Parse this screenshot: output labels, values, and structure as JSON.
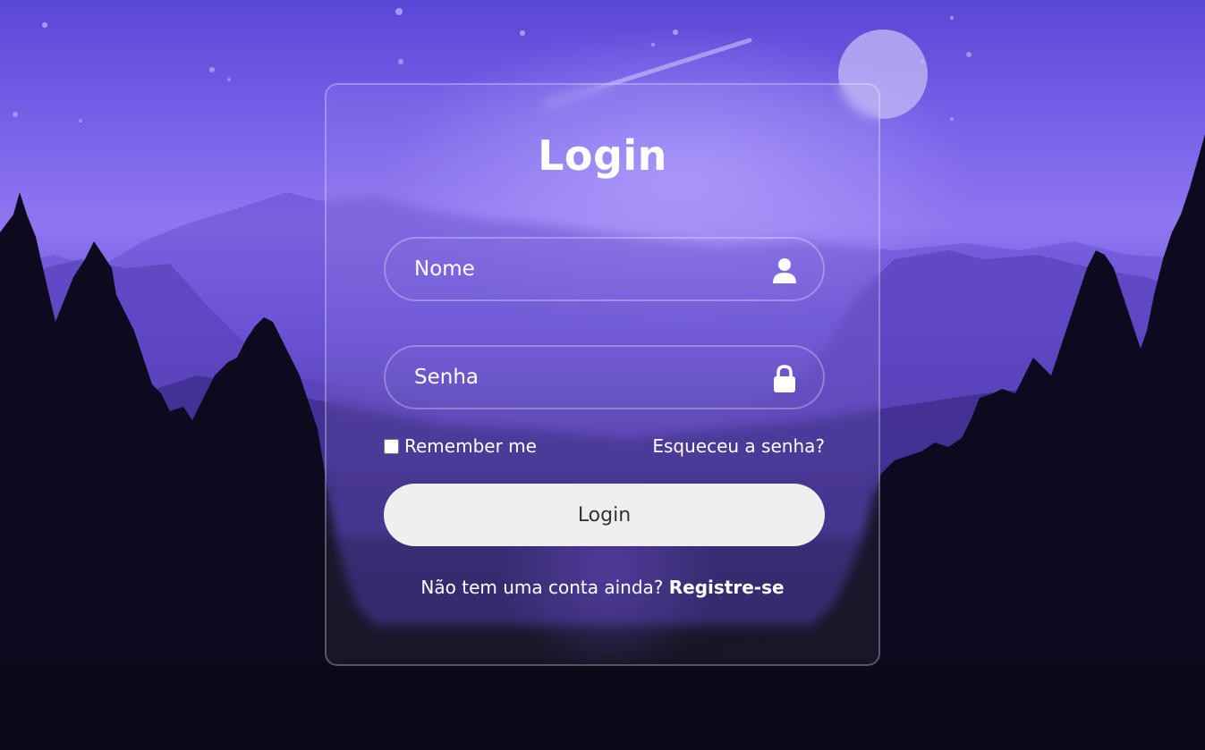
{
  "form": {
    "title": "Login",
    "username": {
      "placeholder": "Nome",
      "icon": "user-icon"
    },
    "password": {
      "placeholder": "Senha",
      "icon": "lock-icon"
    },
    "remember_label": "Remember me",
    "forgot_label": "Esqueceu a senha?",
    "submit_label": "Login",
    "register_prompt": "Não tem uma conta ainda?",
    "register_link": "Registre-se"
  },
  "colors": {
    "sky_top": "#5b47d6",
    "sky_mid": "#8f76f0",
    "forest": "#0d0a1f",
    "button_bg": "#efefef",
    "button_text": "#333333",
    "text": "#ffffff"
  }
}
